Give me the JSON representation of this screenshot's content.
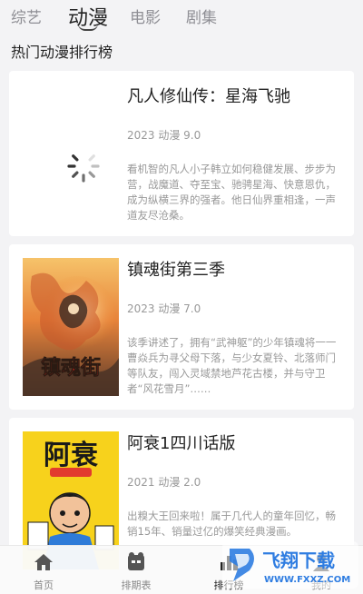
{
  "tabs": [
    {
      "label": "综艺"
    },
    {
      "label": "动漫"
    },
    {
      "label": "电影"
    },
    {
      "label": "剧集"
    }
  ],
  "active_tab": "动漫",
  "section_title": "热门动漫排行榜",
  "cards": [
    {
      "title": "凡人修仙传：星海飞驰",
      "meta": "2023 动漫 9.0",
      "description": "看机智的凡人小子韩立如何稳健发展、步步为营，战魔道、夺至宝、驰骋星海、快意恩仇，成为纵横三界的强者。他日仙界重相逢，一声道友尽沧桑。",
      "thumb_state": "loading"
    },
    {
      "title": "镇魂街第三季",
      "meta": "2023 动漫 7.0",
      "description": "该季讲述了，拥有“武神躯”的少年镇魂将一一曹焱兵为寻父母下落，与少女夏铃、北落师门等队友，闯入灵域禁地芦花古楼，并与守卫者“风花雪月”……",
      "thumb_text": "镇魂街"
    },
    {
      "title": "阿衰1四川话版",
      "meta": "2021 动漫 2.0",
      "description": "出糗大王回来啦！属于几代人的童年回忆，畅销15年、销量过亿的爆笑经典漫画。",
      "thumb_text": "阿衰"
    }
  ],
  "bottom_nav": [
    {
      "label": "首页",
      "icon": "home-icon"
    },
    {
      "label": "排期表",
      "icon": "schedule-icon"
    },
    {
      "label": "排行榜",
      "icon": "ranking-icon",
      "active": true
    },
    {
      "label": "我的",
      "icon": "profile-icon"
    }
  ],
  "watermark": {
    "brand": "飞翔下载",
    "url": "WWW.FXXZ.COM"
  },
  "colors": {
    "background": "#f3f3f5",
    "card": "#ffffff",
    "text_primary": "#222222",
    "text_secondary": "#999999",
    "watermark_blue": "#2f7de1"
  }
}
